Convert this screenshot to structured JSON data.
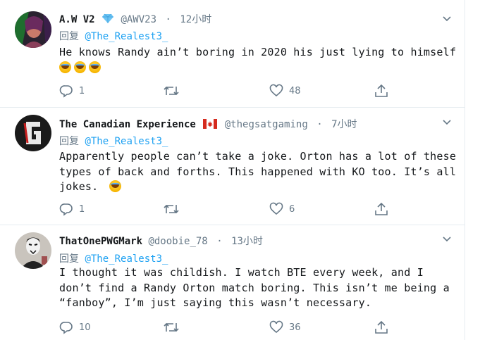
{
  "tweets": [
    {
      "name": "A.W V2",
      "handle": "@AWV23",
      "time": "12小时",
      "reply_prefix": "回复",
      "reply_to": "@The_Realest3_",
      "text": "He knows Randy ain’t boring in 2020 his just lying to himself",
      "badge": "diamond-emoji",
      "trailing_emoji": [
        "joy-emoji",
        "joy-emoji",
        "joy-emoji"
      ],
      "replies": "1",
      "retweets": "",
      "likes": "48"
    },
    {
      "name": "The Canadian Experience",
      "handle": "@thegsatgaming",
      "time": "7小时",
      "reply_prefix": "回复",
      "reply_to": "@The_Realest3_",
      "text": "Apparently people can’t take a joke. Orton has a lot of these types of back and forths. This happened with KO too. It’s all jokes.",
      "badge": "canada-flag-emoji",
      "trailing_emoji": [
        "joy-emoji"
      ],
      "replies": "1",
      "retweets": "",
      "likes": "6"
    },
    {
      "name": "ThatOnePWGMark",
      "handle": "@doobie_78",
      "time": "13小时",
      "reply_prefix": "回复",
      "reply_to": "@The_Realest3_",
      "text": "I thought it was childish. I watch BTE every week, and I don’t find a Randy Orton match boring. This isn’t me being a “fanboy”, I’m just saying this wasn’t necessary.",
      "replies": "10",
      "retweets": "",
      "likes": "36"
    }
  ],
  "icons": {
    "reply": "reply-icon",
    "retweet": "retweet-icon",
    "like": "heart-icon",
    "share": "share-icon",
    "more": "chevron-down-icon"
  },
  "colors": {
    "link": "#1da1f2",
    "secondary": "#657786",
    "border": "#e6ecf0"
  }
}
